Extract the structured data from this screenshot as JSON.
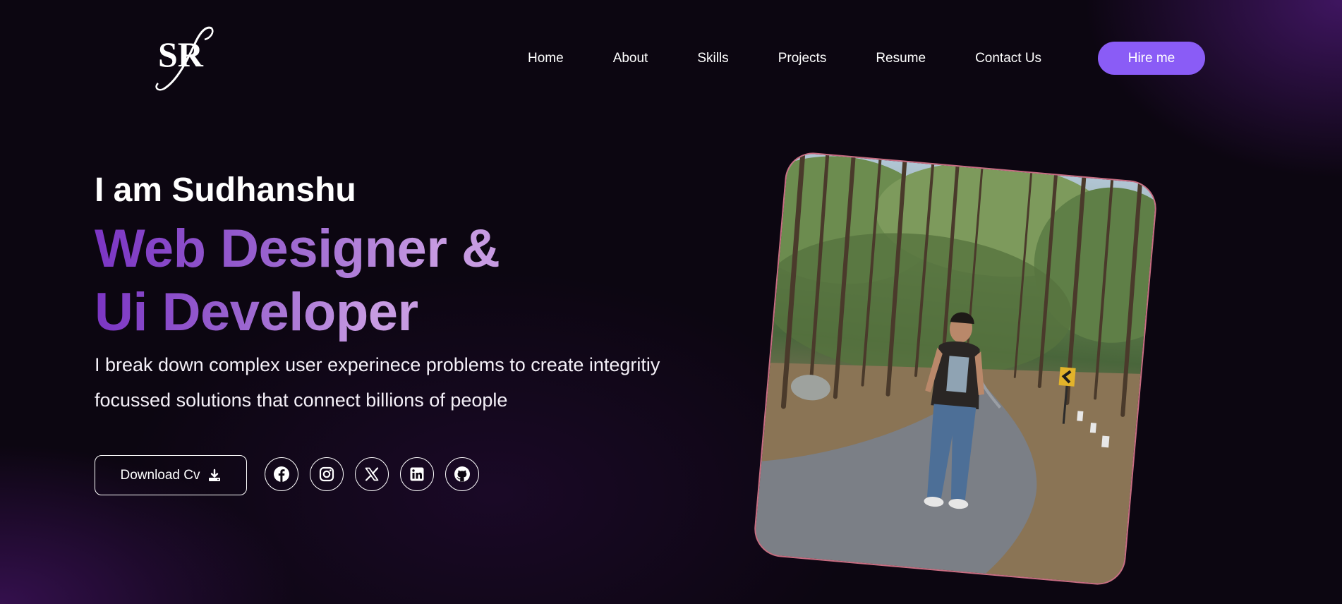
{
  "nav": {
    "logo_text": "SR",
    "links": [
      "Home",
      "About",
      "Skills",
      "Projects",
      "Resume",
      "Contact Us"
    ],
    "hire_label": "Hire me"
  },
  "hero": {
    "intro": "I am Sudhanshu",
    "role_line1": "Web Designer &",
    "role_line2": "Ui Developer",
    "description": "I break down complex user experinece problems to create integritiy focussed solutions that connect billions of people",
    "cv_label": "Download Cv",
    "cv_icon": "download-icon",
    "socials": [
      "facebook-icon",
      "instagram-icon",
      "x-icon",
      "linkedin-icon",
      "github-icon"
    ]
  },
  "colors": {
    "background": "#0c0611",
    "accent_purple": "#8a5cf6",
    "role_gradient_start": "#7b35c4",
    "role_gradient_end": "#c79be2",
    "photo_border": "#c86d82"
  }
}
